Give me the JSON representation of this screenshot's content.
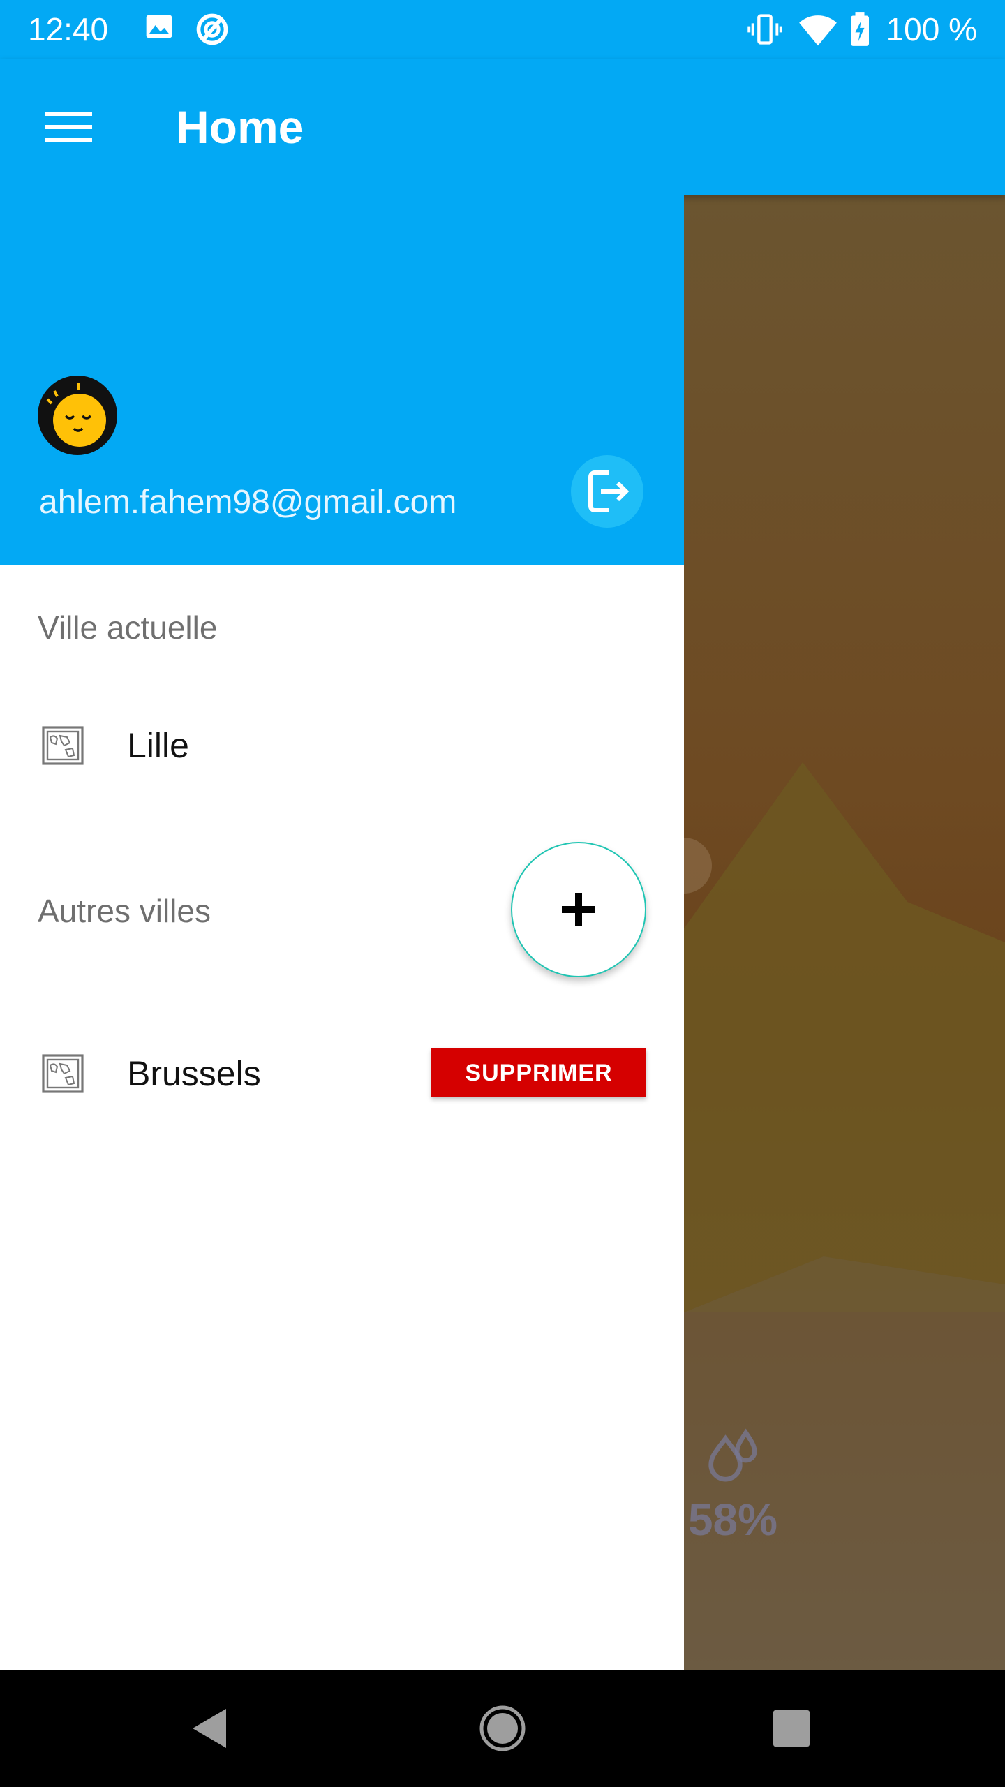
{
  "status_bar": {
    "time": "12:40",
    "icons": [
      "image-icon",
      "sync-circle-icon",
      "vibrate-icon",
      "wifi-icon",
      "battery-charging-icon"
    ],
    "battery_text": "100 %"
  },
  "app_bar": {
    "title": "Home",
    "menu_icon": "hamburger-menu-icon",
    "color": "#03a9f4"
  },
  "drawer": {
    "user": {
      "email": "ahlem.fahem98@gmail.com",
      "avatar_icon": "sleepy-face-avatar"
    },
    "logout_icon": "logout-icon",
    "current_city_label": "Ville actuelle",
    "current_city": {
      "name": "Lille",
      "icon": "map-icon"
    },
    "other_cities_label": "Autres villes",
    "add_button_icon": "plus-icon",
    "other_cities": [
      {
        "name": "Brussels",
        "icon": "map-icon",
        "delete_label": "SUPPRIMER"
      }
    ]
  },
  "background": {
    "humidity_icon": "humidity-drops-icon",
    "humidity": "58%"
  },
  "nav_bar": {
    "icons": [
      "back-triangle-icon",
      "home-circle-icon",
      "recents-square-icon"
    ]
  },
  "colors": {
    "primary": "#03a9f4",
    "delete": "#d50000",
    "fab_border": "#20c5b3"
  }
}
